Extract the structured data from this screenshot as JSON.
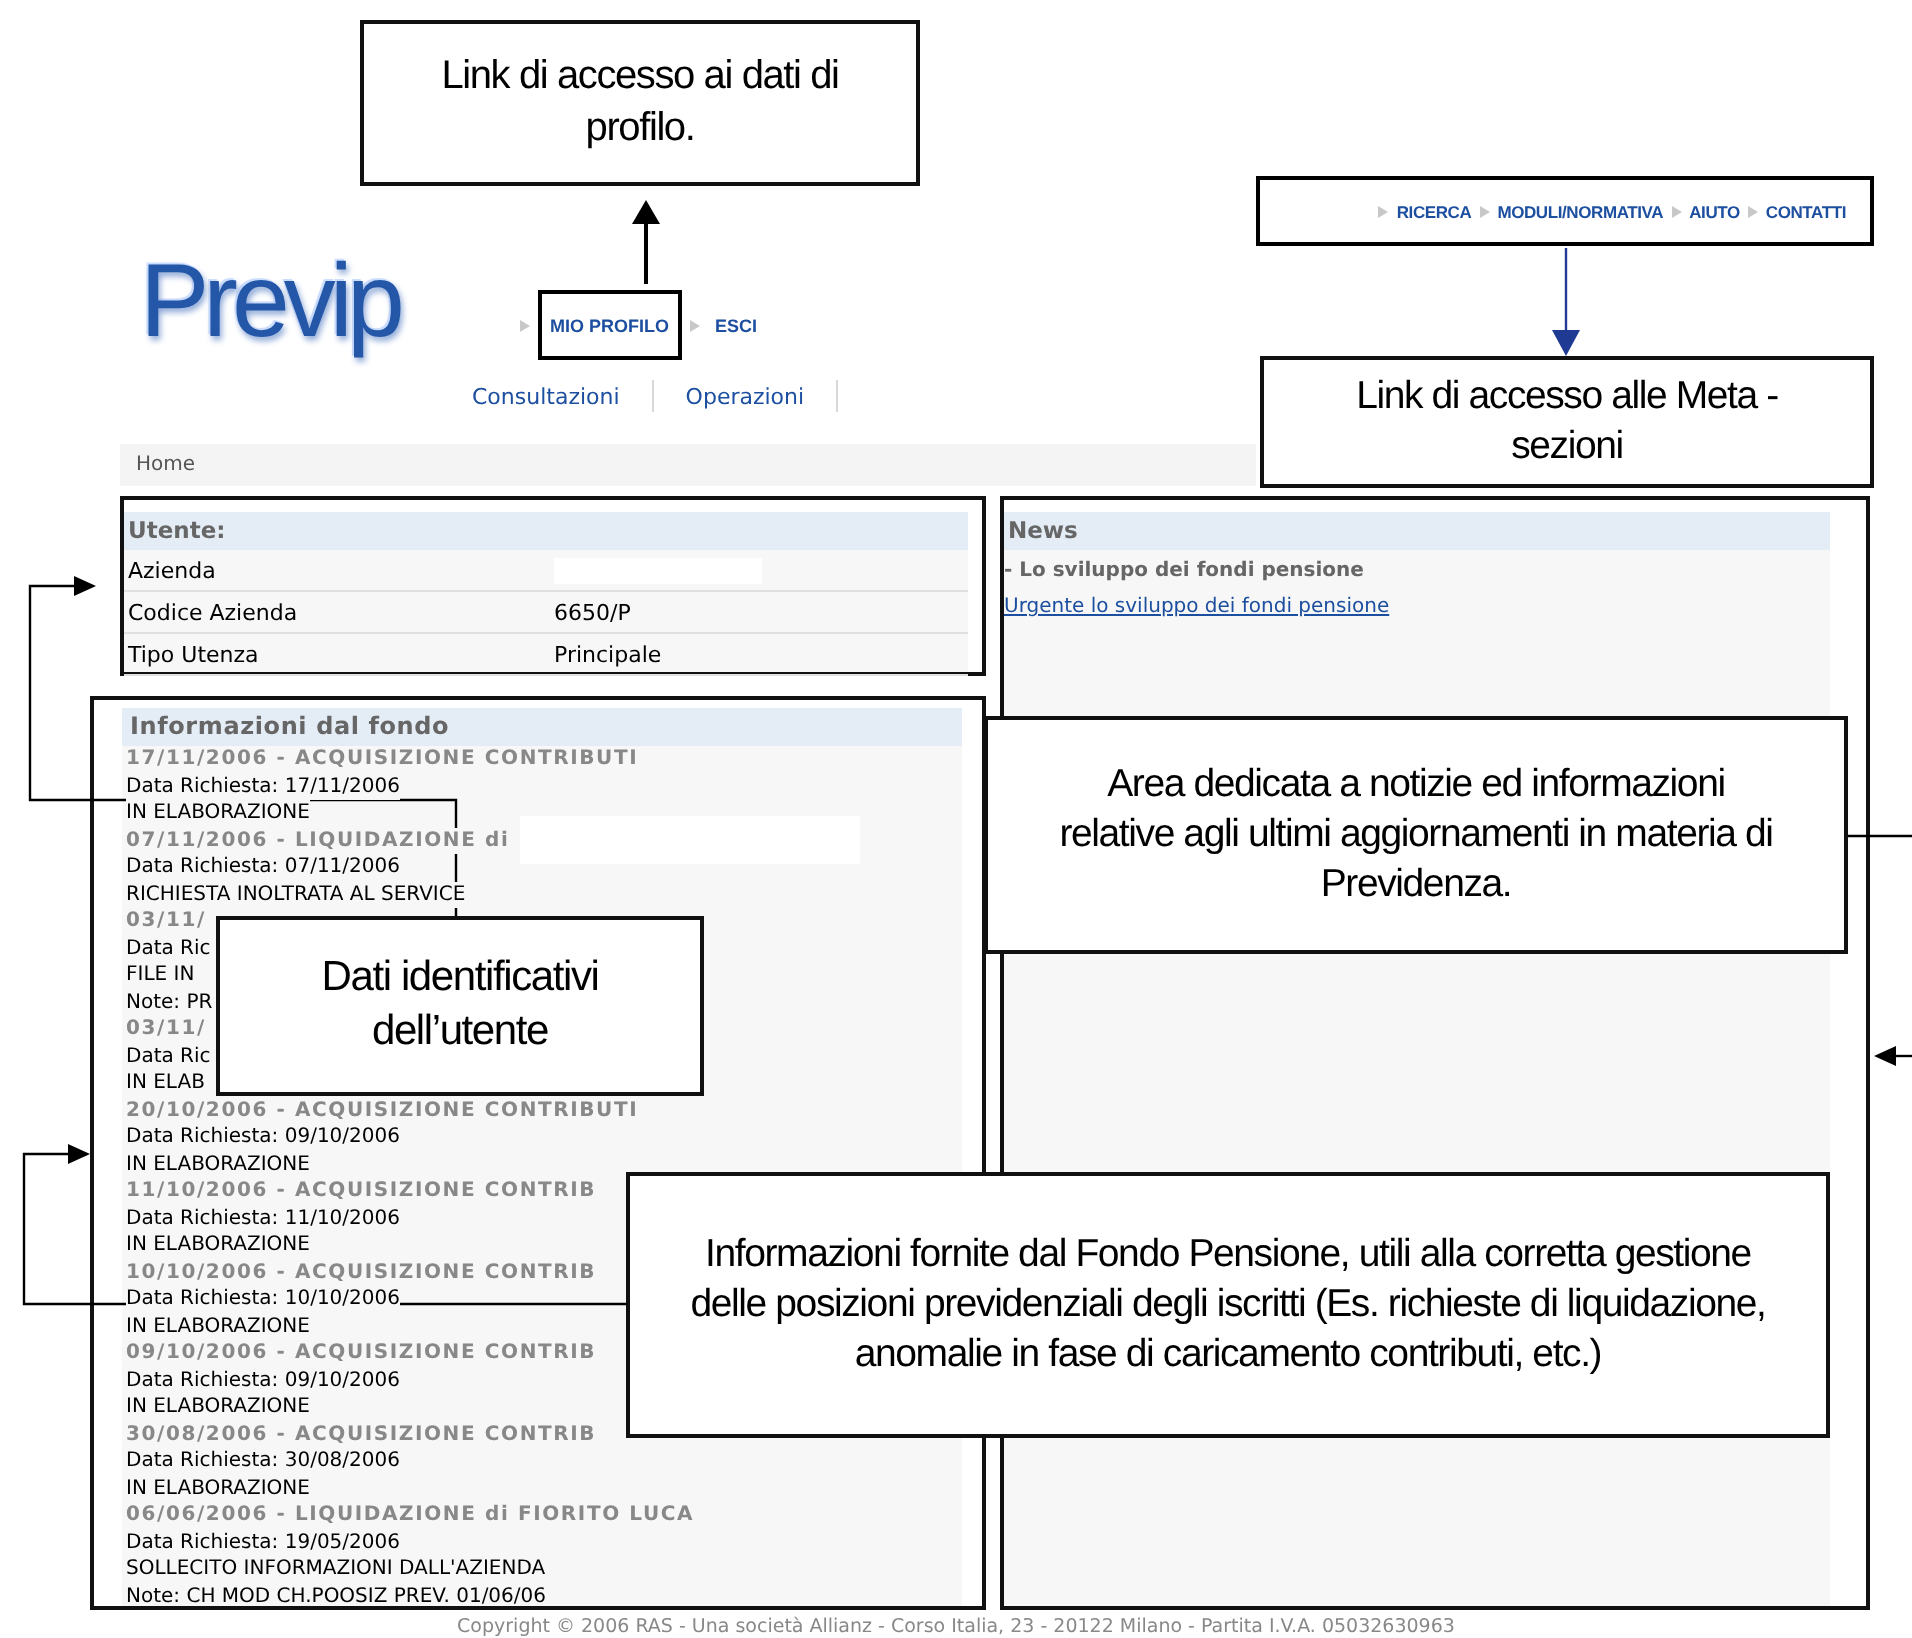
{
  "header": {
    "logo": "Previp",
    "profile_links": [
      {
        "label": "MIO PROFILO",
        "highlighted": true
      },
      {
        "label": "ESCI",
        "highlighted": false
      }
    ],
    "meta_links": [
      "RICERCA",
      "MODULI/NORMATIVA",
      "AIUTO",
      "CONTATTI"
    ],
    "tabs": [
      "Consultazioni",
      "Operazioni"
    ]
  },
  "breadcrumb": "Home",
  "user_panel": {
    "title": "Utente:",
    "rows": [
      {
        "label": "Azienda",
        "redacted": true
      },
      {
        "label": "Codice Azienda",
        "value": "6650/P",
        "redacted": false
      },
      {
        "label": "Tipo Utenza",
        "value": "Principale",
        "redacted": false
      }
    ]
  },
  "info_panel": {
    "title": "Informazioni dal fondo",
    "entries": [
      {
        "kind": "heading",
        "text": "17/11/2006 - ACQUISIZIONE CONTRIBUTI"
      },
      {
        "kind": "line",
        "text": "Data Richiesta: 17/11/2006"
      },
      {
        "kind": "line",
        "text": "IN ELABORAZIONE"
      },
      {
        "kind": "heading",
        "text": "07/11/2006 - LIQUIDAZIONE di",
        "redacted": true
      },
      {
        "kind": "line",
        "text": "Data Richiesta: 07/11/2006"
      },
      {
        "kind": "line",
        "text": "RICHIESTA INOLTRATA AL SERVICE"
      },
      {
        "kind": "heading",
        "text": "03/11/"
      },
      {
        "kind": "line",
        "text": "Data Ric"
      },
      {
        "kind": "line",
        "text": "FILE IN"
      },
      {
        "kind": "line",
        "text": "Note: PR"
      },
      {
        "kind": "heading",
        "text": "03/11/"
      },
      {
        "kind": "line",
        "text": "Data Ric"
      },
      {
        "kind": "line",
        "text": "IN ELAB"
      },
      {
        "kind": "heading",
        "text": "20/10/2006 - ACQUISIZIONE CONTRIBUTI"
      },
      {
        "kind": "line",
        "text": "Data Richiesta: 09/10/2006"
      },
      {
        "kind": "line",
        "text": "IN ELABORAZIONE"
      },
      {
        "kind": "heading",
        "text": "11/10/2006 - ACQUISIZIONE CONTRIB"
      },
      {
        "kind": "line",
        "text": "Data Richiesta: 11/10/2006"
      },
      {
        "kind": "line",
        "text": "IN ELABORAZIONE"
      },
      {
        "kind": "heading",
        "text": "10/10/2006 - ACQUISIZIONE CONTRIB"
      },
      {
        "kind": "line",
        "text": "Data Richiesta: 10/10/2006"
      },
      {
        "kind": "line",
        "text": "IN ELABORAZIONE"
      },
      {
        "kind": "heading",
        "text": "09/10/2006 - ACQUISIZIONE CONTRIB"
      },
      {
        "kind": "line",
        "text": "Data Richiesta: 09/10/2006"
      },
      {
        "kind": "line",
        "text": "IN ELABORAZIONE"
      },
      {
        "kind": "heading",
        "text": "30/08/2006 - ACQUISIZIONE CONTRIB"
      },
      {
        "kind": "line",
        "text": "Data Richiesta: 30/08/2006"
      },
      {
        "kind": "line",
        "text": "IN ELABORAZIONE"
      },
      {
        "kind": "heading",
        "text": "06/06/2006 - LIQUIDAZIONE di FIORITO LUCA"
      },
      {
        "kind": "line",
        "text": "Data Richiesta: 19/05/2006"
      },
      {
        "kind": "line",
        "text": "SOLLECITO INFORMAZIONI DALL'AZIENDA"
      },
      {
        "kind": "line",
        "text": "Note: CH MOD CH.POOSIZ PREV. 01/06/06"
      }
    ]
  },
  "news_panel": {
    "title": "News",
    "items": [
      {
        "title": "- Lo sviluppo dei fondi pensione",
        "link": "Urgente lo sviluppo dei fondi pensione"
      }
    ]
  },
  "footer": "Copyright © 2006 RAS - Una società Allianz - Corso Italia, 23 - 20122 Milano - Partita I.V.A. 05032630963",
  "annotations": [
    {
      "text": "Link di accesso ai dati di profilo."
    },
    {
      "text": "Link di accesso alle Meta - sezioni"
    },
    {
      "text": "Area dedicata a notizie ed informazioni relative agli ultimi aggiornamenti in materia di  Previdenza."
    },
    {
      "text": "Dati identificativi dell’utente"
    },
    {
      "text": "Informazioni fornite dal Fondo Pensione, utili alla corretta gestione delle posizioni previdenziali degli iscritti (Es. richieste di liquidazione, anomalie in fase di caricamento contributi, etc.)"
    }
  ]
}
